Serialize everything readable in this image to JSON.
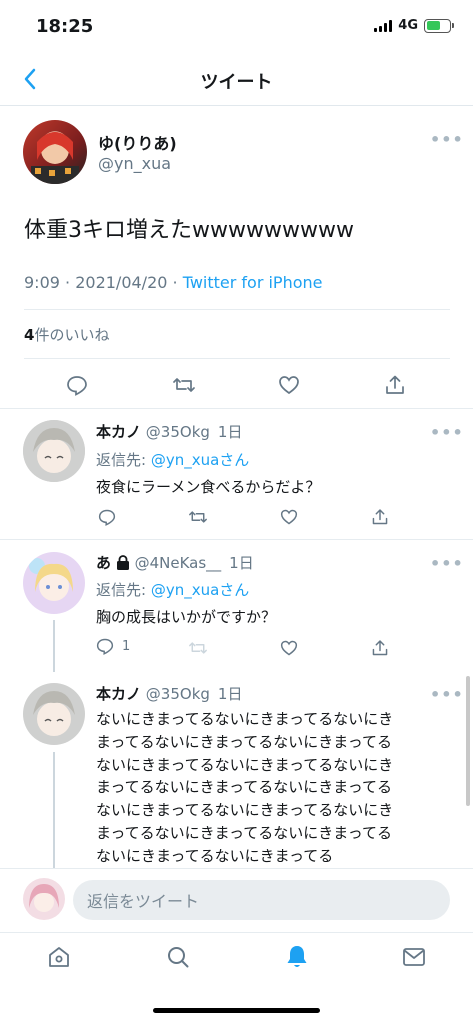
{
  "status_bar": {
    "time": "18:25",
    "network": "4G"
  },
  "nav": {
    "title": "ツイート"
  },
  "main_tweet": {
    "display_name": "ゆ(りりあ)",
    "handle": "@yn_xua",
    "text": "体重3キロ増えたwwwwwwwww",
    "time": "9:09",
    "date": "2021/04/20",
    "separator": " · ",
    "client": "Twitter for iPhone",
    "likes_count": "4",
    "likes_label": "件のいいね"
  },
  "replies": [
    {
      "display_name": "本カノ",
      "handle": "@35Okg",
      "time": "1日",
      "reply_to_label": "返信先:",
      "reply_to": "@yn_xuaさん",
      "text": "夜食にラーメン食べるからだよ？",
      "reply_count": ""
    },
    {
      "display_name": "あ",
      "handle": "@4NeKas__",
      "time": "1日",
      "reply_to_label": "返信先:",
      "reply_to": "@yn_xuaさん",
      "text": "胸の成長はいかがですか？",
      "reply_count": "1"
    },
    {
      "display_name": "本カノ",
      "handle": "@35Okg",
      "time": "1日",
      "lines": [
        "ないにきまってるないにきまってるないにき",
        "まってるないにきまってるないにきまってる",
        "ないにきまってるないにきまってるないにき",
        "まってるないにきまってるないにきまってる",
        "ないにきまってるないにきまってるないにき",
        "まってるないにきまってるないにきまってる",
        "ないにきまってるないにきまってる"
      ]
    }
  ],
  "compose": {
    "placeholder": "返信をツイート"
  },
  "colors": {
    "accent": "#1da1f2",
    "muted": "#657786",
    "divider": "#e6ecf0"
  },
  "tabs": [
    "home-icon",
    "search-icon",
    "notifications-icon",
    "messages-icon"
  ]
}
